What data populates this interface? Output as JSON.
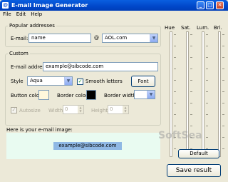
{
  "window": {
    "title": "E-mail Image Generator",
    "app_icon": "@",
    "minimize": "_",
    "maximize": "□",
    "close": "✕"
  },
  "menu": [
    "File",
    "Edit",
    "Help"
  ],
  "popular": {
    "legend": "Popular addresses",
    "email_label": "E-mail:",
    "name_value": "name",
    "at": "@",
    "domain_value": "AOL.com"
  },
  "custom": {
    "legend": "Custom",
    "email_address_label": "E-mail address",
    "email_address_value": "example@sibcode.com",
    "style_label": "Style",
    "style_value": "Aqua",
    "smooth_label": "Smooth letters",
    "smooth_checked": true,
    "font_button": "Font",
    "button_color_label": "Button color",
    "button_color": "#fff8dc",
    "border_color_label": "Border color",
    "border_color": "#000000",
    "border_width_label": "Border width",
    "border_width_value": "",
    "autosize_label": "Autosize",
    "width_label": "Width",
    "width_value": "0",
    "height_label": "Height",
    "height_value": "0"
  },
  "preview": {
    "label": "Here is your e-mail image:",
    "email_text": "example@sibcode.com",
    "background": "#e9fbf1"
  },
  "adjust": {
    "labels": [
      "Hue",
      "Sat.",
      "Lum.",
      "Bri."
    ],
    "default_button": "Default",
    "save_button": "Save result"
  },
  "watermark": "SoftSea"
}
